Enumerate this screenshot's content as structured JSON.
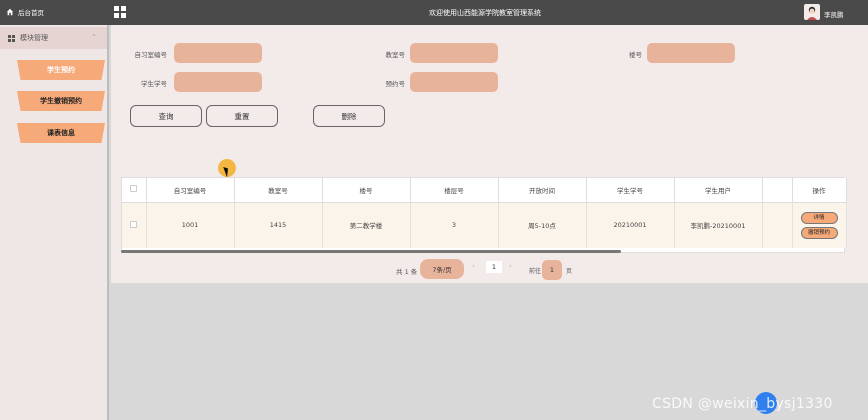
{
  "topbar": {
    "home_label": "后台首页",
    "title": "欢迎使用山西能源学院教室管理系统",
    "user_name": "李凯鹏"
  },
  "sidebar": {
    "module_label": "模块管理",
    "items": [
      {
        "label": "学生预约",
        "active": true
      },
      {
        "label": "学生撤销预约",
        "active": false
      },
      {
        "label": "课表信息",
        "active": false
      }
    ]
  },
  "search": {
    "room_no_label": "自习室编号",
    "classroom_label": "教室号",
    "building_label": "楼号",
    "student_id_label": "学生学号",
    "booking_no_label": "预约号",
    "room_no_value": "",
    "classroom_value": "",
    "building_value": "",
    "student_id_value": "",
    "booking_no_value": ""
  },
  "buttons": {
    "query": "查询",
    "reset": "重置",
    "delete": "删除"
  },
  "table": {
    "headers": [
      "自习室编号",
      "教室号",
      "楼号",
      "楼层号",
      "开放时间",
      "学生学号",
      "学生用户",
      "",
      "操作"
    ],
    "rows": [
      {
        "room_no": "1001",
        "classroom": "1415",
        "building": "第二教学楼",
        "floor": "3",
        "open_time": "周5-10点",
        "student_id": "20210001",
        "student_user": "李凯鹏-20210001",
        "extra": "",
        "detail_label": "详情",
        "cancel_label": "撤销预约"
      }
    ]
  },
  "pagination": {
    "total": "共 1 条",
    "page_size": "7条/页",
    "current_page": "1",
    "goto_label": "前往",
    "goto_value": "1",
    "page_suffix": "页"
  },
  "watermark": "CSDN @weixin_bysj1330",
  "colors": {
    "accent": "#f6a979",
    "input_bg": "#e8b39b",
    "topbar": "#4a4a4a"
  }
}
